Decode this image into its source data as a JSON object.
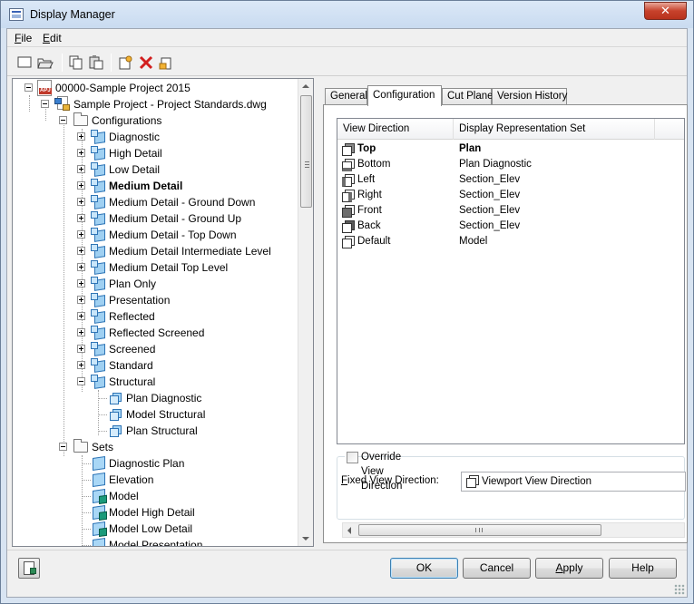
{
  "window": {
    "title": "Display Manager",
    "close": "✕"
  },
  "menu": [
    {
      "label": "File",
      "accel": "F",
      "rest": "ile"
    },
    {
      "label": "Edit",
      "accel": "E",
      "rest": "dit"
    }
  ],
  "toolbar": {
    "icons": [
      "new-icon",
      "open-icon",
      "copy-icon",
      "paste-icon",
      "new-style-icon",
      "delete-icon",
      "purge-icon"
    ]
  },
  "tree": {
    "project": "00000-Sample Project 2015",
    "drawing": "Sample Project - Project Standards.dwg",
    "configurations_label": "Configurations",
    "configurations": [
      "Diagnostic",
      "High Detail",
      "Low Detail",
      "Medium Detail",
      "Medium Detail - Ground Down",
      "Medium Detail - Ground Up",
      "Medium Detail - Top Down",
      "Medium Detail Intermediate Level",
      "Medium Detail Top Level",
      "Plan Only",
      "Presentation",
      "Reflected",
      "Reflected Screened",
      "Screened",
      "Standard",
      "Structural"
    ],
    "bold_configuration": "Medium Detail",
    "structural_children": [
      "Plan Diagnostic",
      "Model Structural",
      "Plan Structural"
    ],
    "sets_label": "Sets",
    "sets": [
      "Diagnostic Plan",
      "Elevation",
      "Model",
      "Model High Detail",
      "Model Low Detail",
      "Model Presentation"
    ]
  },
  "tabs": [
    "General",
    "Configuration",
    "Cut Plane",
    "Version History"
  ],
  "active_tab": "Configuration",
  "listview": {
    "columns": [
      "View Direction",
      "Display Representation Set"
    ],
    "rows": [
      {
        "view": "Top",
        "set": "Plan",
        "bold": true,
        "icon": "view-top-icon"
      },
      {
        "view": "Bottom",
        "set": "Plan Diagnostic",
        "bold": false,
        "icon": "view-bottom-icon"
      },
      {
        "view": "Left",
        "set": "Section_Elev",
        "bold": false,
        "icon": "view-left-icon"
      },
      {
        "view": "Right",
        "set": "Section_Elev",
        "bold": false,
        "icon": "view-right-icon"
      },
      {
        "view": "Front",
        "set": "Section_Elev",
        "bold": false,
        "icon": "view-front-icon"
      },
      {
        "view": "Back",
        "set": "Section_Elev",
        "bold": false,
        "icon": "view-back-icon"
      },
      {
        "view": "Default",
        "set": "Model",
        "bold": false,
        "icon": "view-default-icon"
      }
    ]
  },
  "override": {
    "checkbox_label": "Override View Direction",
    "checked": false,
    "fixed_label_accel": "F",
    "fixed_label_rest": "ixed View Direction:",
    "fixed_value": "Viewport View Direction"
  },
  "buttons": {
    "ok": "OK",
    "cancel": "Cancel",
    "apply_accel": "A",
    "apply_rest": "pply",
    "help": "Help"
  }
}
